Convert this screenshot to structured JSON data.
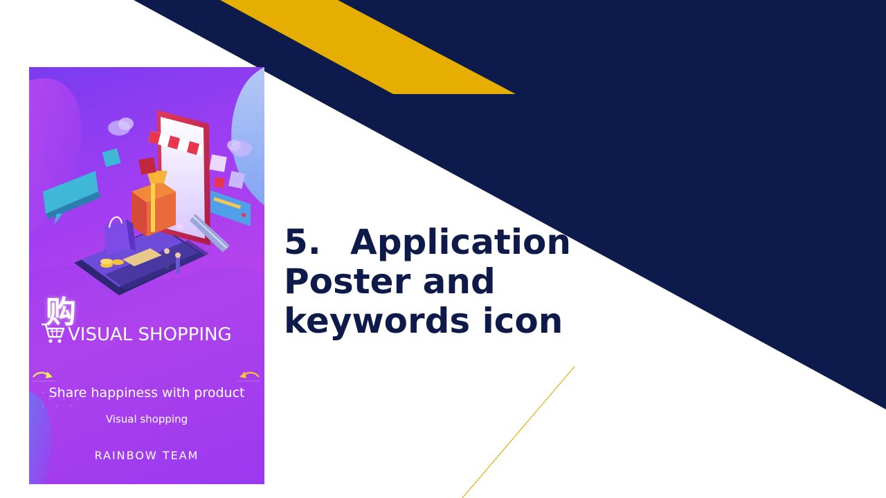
{
  "slide": {
    "heading_number": "5.",
    "heading_line1": "Application",
    "heading_line2": "Poster and",
    "heading_line3": "keywords icon"
  },
  "poster": {
    "chinese_char": "购",
    "title": "VISUAL SHOPPING",
    "tagline": "Share happiness with product",
    "subtitle": "Visual shopping",
    "team": "RAINBOW TEAM"
  },
  "colors": {
    "navy": "#0d1b4c",
    "gold": "#e6ae00",
    "poster_purple": "#a43ef2"
  },
  "icons": [
    "shopping-cart-icon",
    "phone-shop-illustration",
    "gift-box-icon",
    "shopping-bag-icon",
    "cloud-icon",
    "credit-card-icon",
    "chat-bubble-icon",
    "arrow-icon"
  ]
}
